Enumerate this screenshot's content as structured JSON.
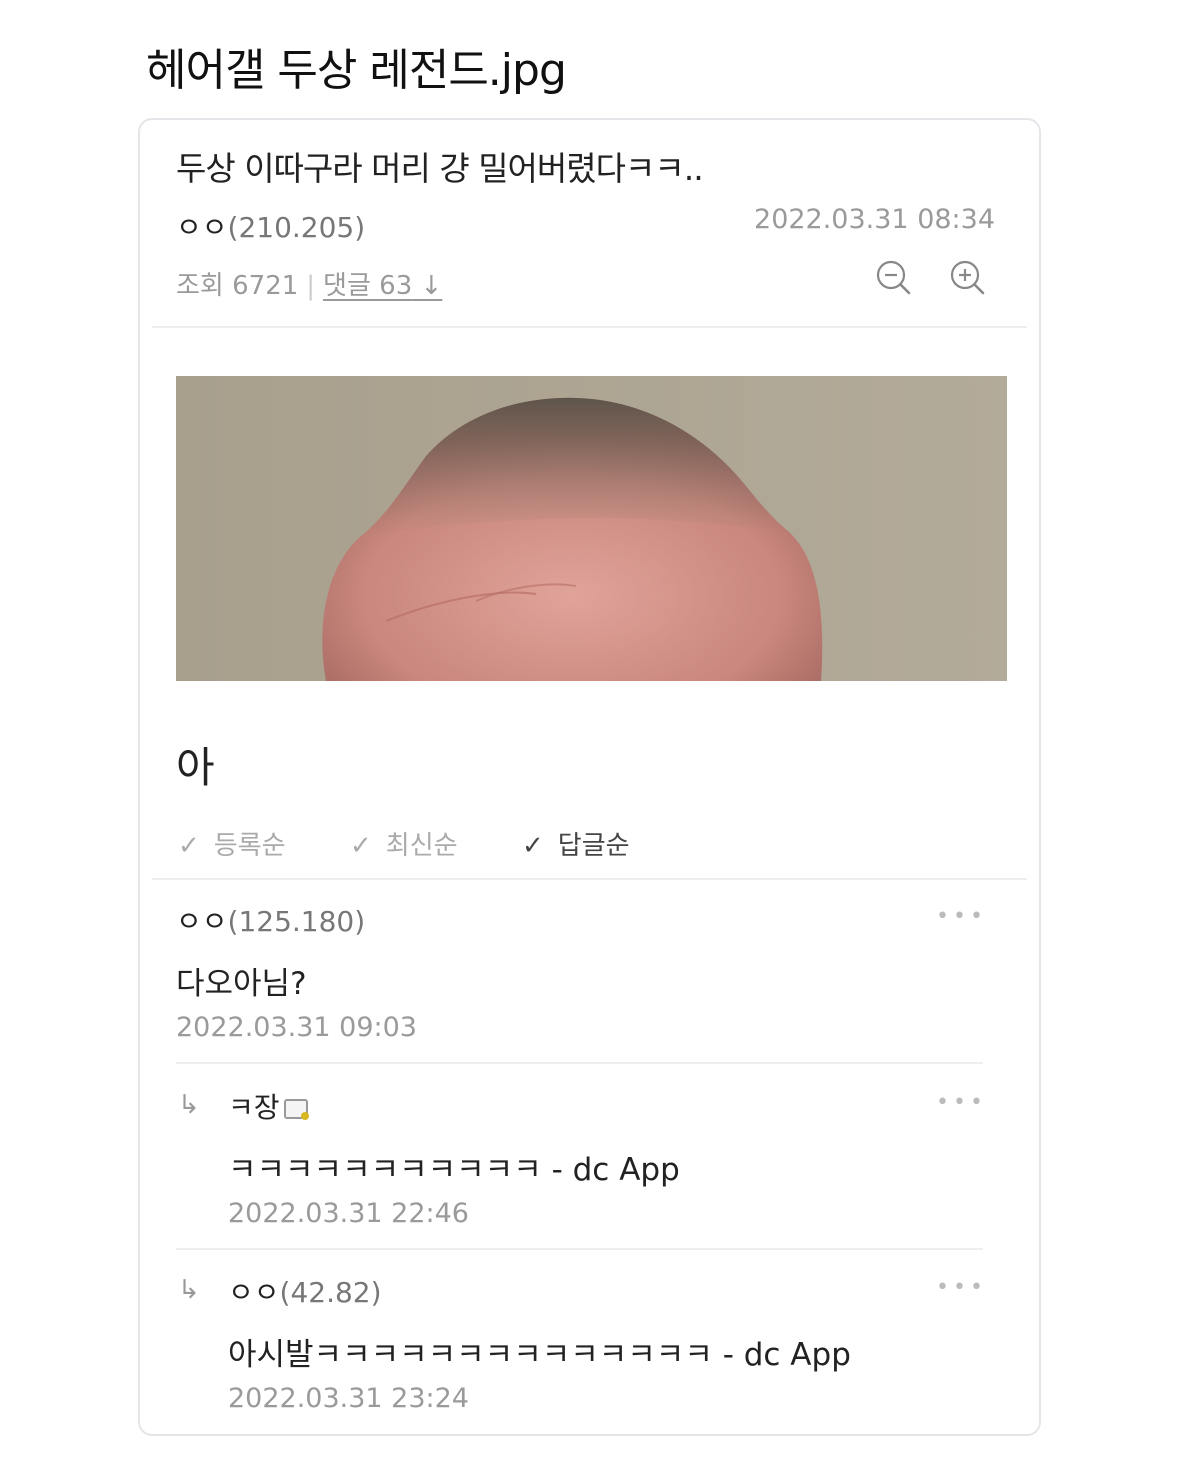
{
  "page": {
    "title": "헤어갤 두상 레전드.jpg"
  },
  "post": {
    "title": "두상 이따구라 머리 걍 밀어버렸다ㅋㅋ..",
    "author_nick": "ㅇㅇ",
    "author_ip": "(210.205)",
    "date": "2022.03.31 08:34",
    "views_label": "조회 6721",
    "comments_label": "댓글 63",
    "comments_icon": "arrow-down-icon",
    "zoom_out_icon": "zoom-out-icon",
    "zoom_in_icon": "zoom-in-icon",
    "image_icon": "shaved-head-photo",
    "body": "아"
  },
  "sort_options": [
    {
      "label": "등록순",
      "active": false
    },
    {
      "label": "최신순",
      "active": false
    },
    {
      "label": "답글순",
      "active": true
    }
  ],
  "comments": [
    {
      "nick": "ㅇㅇ",
      "ip": "(125.180)",
      "text": "다오아님?",
      "date": "2022.03.31 09:03",
      "reply": false
    },
    {
      "nick": "ㅋ장",
      "ip": "",
      "text": "ㅋㅋㅋㅋㅋㅋㅋㅋㅋㅋㅋ - dc App",
      "date": "2022.03.31 22:46",
      "reply": true,
      "badge_icon": "gallery-manager-badge-icon"
    },
    {
      "nick": "ㅇㅇ",
      "ip": "(42.82)",
      "text": "아시발ㅋㅋㅋㅋㅋㅋㅋㅋㅋㅋㅋㅋㅋㅋ - dc App",
      "date": "2022.03.31 23:24",
      "reply": true
    }
  ],
  "colors": {
    "muted": "#9a9a9a",
    "divider": "#eeeeee",
    "card_border": "#e6e6ea"
  }
}
